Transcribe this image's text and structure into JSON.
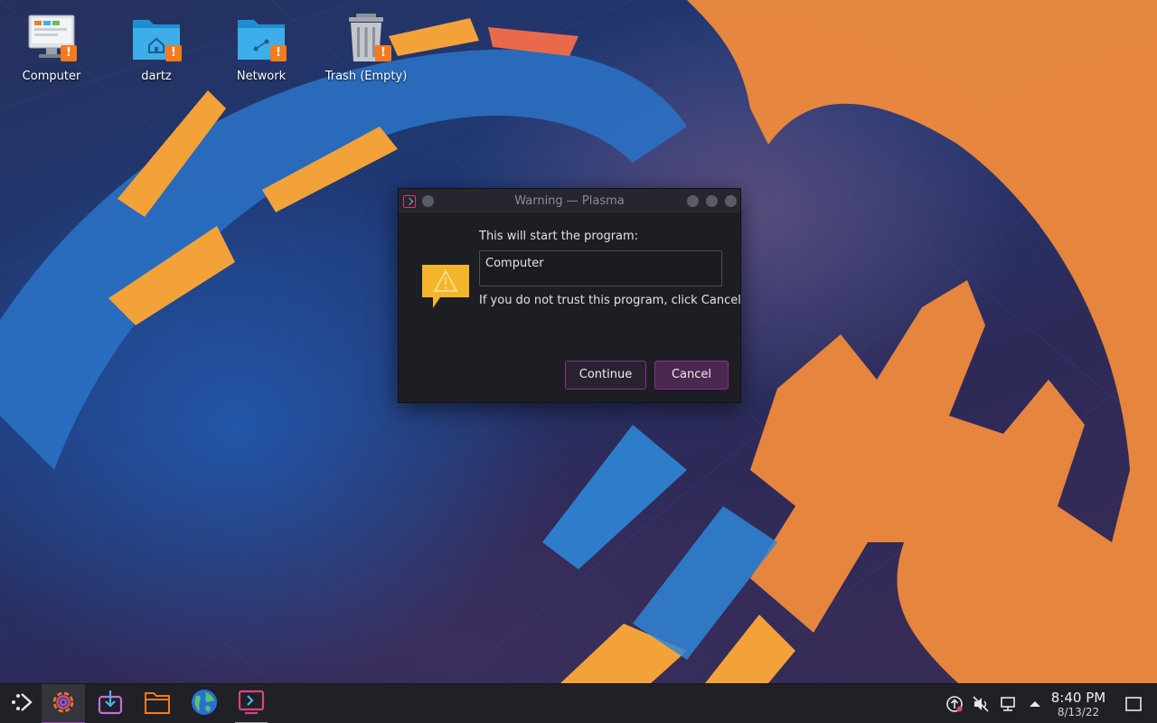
{
  "desktop": {
    "icons": [
      {
        "name": "computer",
        "label": "Computer",
        "icon": "computer-icon"
      },
      {
        "name": "dartz",
        "label": "dartz",
        "icon": "home-folder-icon"
      },
      {
        "name": "network",
        "label": "Network",
        "icon": "network-folder-icon"
      },
      {
        "name": "trash",
        "label": "Trash (Empty)",
        "icon": "trash-icon"
      }
    ],
    "badge_text": "!"
  },
  "dialog": {
    "title": "Warning — Plasma",
    "message": "This will start the program:",
    "program": "Computer",
    "hint": "If you do not trust this program, click Cancel",
    "continue_label": "Continue",
    "cancel_label": "Cancel"
  },
  "taskbar": {
    "launchers": [
      {
        "name": "application-launcher",
        "icon": "launcher-icon"
      },
      {
        "name": "system-settings",
        "icon": "gear-icon",
        "state": "active"
      },
      {
        "name": "discover",
        "icon": "software-center-icon"
      },
      {
        "name": "dolphin",
        "icon": "folder-icon"
      },
      {
        "name": "web-browser",
        "icon": "globe-icon"
      },
      {
        "name": "return-to-gaming",
        "icon": "terminal-icon",
        "state": "running"
      }
    ],
    "tray": [
      "update-icon",
      "volume-muted-icon",
      "network-wired-icon",
      "tray-expand-icon"
    ],
    "clock": {
      "time": "8:40 PM",
      "date": "8/13/22"
    }
  },
  "colors": {
    "accent": "#a63eaa",
    "badge": "#f47a1e",
    "folder": "#3daee9",
    "warning": "#f5b52b"
  }
}
